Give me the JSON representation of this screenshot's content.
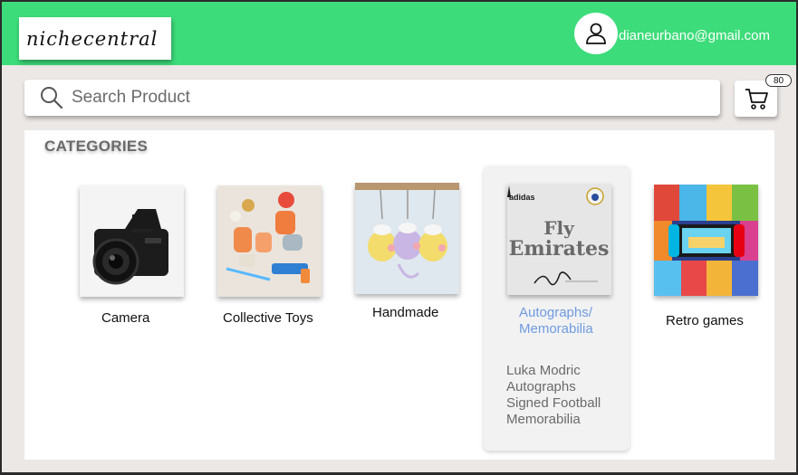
{
  "header": {
    "logo_text": "nichecentral",
    "user_email": "dianeurbano@gmail.com",
    "bg_color": "#3ddc7a"
  },
  "search": {
    "placeholder": "Search Product",
    "icon": "search-icon"
  },
  "cart": {
    "icon": "cart-icon",
    "count": "80"
  },
  "categories": {
    "title": "CATEGORIES",
    "items": [
      {
        "label": "Camera",
        "icon": "camera-image"
      },
      {
        "label": "Collective Toys",
        "icon": "toys-image"
      },
      {
        "label": "Handmade",
        "icon": "crochet-keychains-image"
      },
      {
        "label": "Autographs/ Memorabilia",
        "icon": "signed-jersey-image",
        "selected": true,
        "accent_color": "#6e9be0",
        "image_text": {
          "brand": "adidas",
          "sponsor_line1": "Fly",
          "sponsor_line2": "Emirates"
        }
      },
      {
        "label": "Retro games",
        "icon": "retro-games-image"
      }
    ],
    "selected_description": "Luka Modric Autographs Signed Football Memorabilia"
  }
}
